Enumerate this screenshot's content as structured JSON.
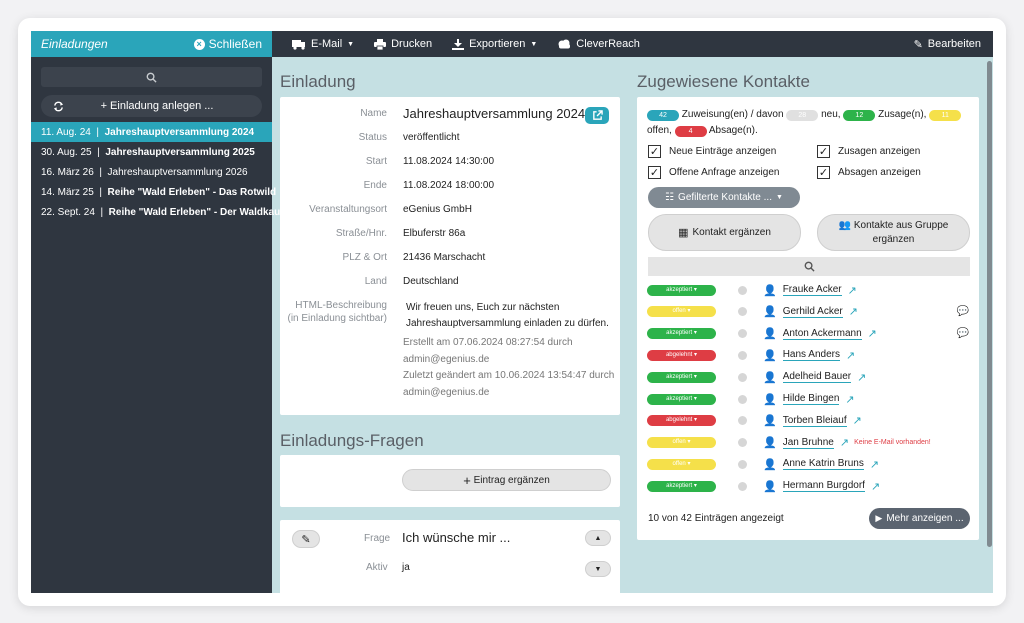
{
  "sidebar": {
    "title": "Einladungen",
    "close_label": "Schließen",
    "new_label": "Einladung anlegen ...",
    "items": [
      {
        "date": "11. Aug. 24",
        "name": "Jahreshauptversammlung 2024",
        "active": true
      },
      {
        "date": "30. Aug. 25",
        "name": "Jahreshauptversammlung 2025",
        "active": false
      },
      {
        "date": "16. März 26",
        "name": "Jahreshauptversammlung 2026",
        "active": false
      },
      {
        "date": "14. März 25",
        "name": "Reihe \"Wald Erleben\" - Das Rotwild",
        "active": false
      },
      {
        "date": "22. Sept. 24",
        "name": "Reihe \"Wald Erleben\" - Der Waldkauz",
        "active": false
      }
    ]
  },
  "toolbar": {
    "email": "E-Mail",
    "print": "Drucken",
    "export": "Exportieren",
    "cleverreach": "CleverReach",
    "edit": "Bearbeiten"
  },
  "invitation": {
    "heading": "Einladung",
    "name_label": "Name",
    "name": "Jahreshauptversammlung 2024",
    "status_label": "Status",
    "status": "veröffentlicht",
    "start_label": "Start",
    "start": "11.08.2024 14:30:00",
    "end_label": "Ende",
    "end": "11.08.2024 18:00:00",
    "venue_label": "Veranstaltungsort",
    "venue": "eGenius GmbH",
    "street_label": "Straße/Hnr.",
    "street": "Elbuferstr 86a",
    "zip_label": "PLZ & Ort",
    "zip": "21436 Marschacht",
    "country_label": "Land",
    "country": "Deutschland",
    "desc_label_1": "HTML-Beschreibung",
    "desc_label_2": "(in Einladung sichtbar)",
    "desc_1": "Wir freuen uns, Euch zur nächsten",
    "desc_2": "Jahreshauptversammlung einladen zu dürfen.",
    "created_1": "Erstellt am 07.06.2024 08:27:54 durch",
    "created_2": "admin@egenius.de",
    "modified_1": "Zuletzt geändert am 10.06.2024 13:54:47 durch",
    "modified_2": "admin@egenius.de"
  },
  "questions": {
    "heading": "Einladungs-Fragen",
    "add_label": "Eintrag ergänzen",
    "question_label": "Frage",
    "question": "Ich wünsche mir ...",
    "active_label": "Aktiv",
    "active": "ja"
  },
  "contacts": {
    "heading": "Zugewiesene Kontakte",
    "total": "42",
    "total_text": "Zuweisung(en) / davon",
    "new_count": "28",
    "new_text": "neu,",
    "accept_count": "12",
    "accept_text": "Zusage(n),",
    "open_count": "11",
    "open_text": "offen,",
    "reject_count": "4",
    "reject_text": "Absage(n).",
    "cb_new": "Neue Einträge anzeigen",
    "cb_accept": "Zusagen anzeigen",
    "cb_open": "Offene Anfrage anzeigen",
    "cb_reject": "Absagen anzeigen",
    "filter_label": "Gefilterte Kontakte ...",
    "add_contact": "Kontakt ergänzen",
    "add_group_1": "Kontakte aus Gruppe",
    "add_group_2": "ergänzen",
    "rows": [
      {
        "status": "akzeptiert",
        "kind": "ok",
        "name": "Frauke Acker",
        "chat": false,
        "note": ""
      },
      {
        "status": "offen",
        "kind": "open",
        "name": "Gerhild Acker",
        "chat": true,
        "note": ""
      },
      {
        "status": "akzeptiert",
        "kind": "ok",
        "name": "Anton Ackermann",
        "chat": true,
        "note": ""
      },
      {
        "status": "abgelehnt",
        "kind": "rej",
        "name": "Hans Anders",
        "chat": false,
        "note": ""
      },
      {
        "status": "akzeptiert",
        "kind": "ok",
        "name": "Adelheid Bauer",
        "chat": false,
        "note": ""
      },
      {
        "status": "akzeptiert",
        "kind": "ok",
        "name": "Hilde Bingen",
        "chat": false,
        "note": ""
      },
      {
        "status": "abgelehnt",
        "kind": "rej",
        "name": "Torben Bleiauf",
        "chat": false,
        "note": ""
      },
      {
        "status": "offen",
        "kind": "open",
        "name": "Jan Bruhne",
        "chat": false,
        "note": "Keine E-Mail vorhanden!"
      },
      {
        "status": "offen",
        "kind": "open",
        "name": "Anne Katrin Bruns",
        "chat": false,
        "note": ""
      },
      {
        "status": "akzeptiert",
        "kind": "ok",
        "name": "Hermann Burgdorf",
        "chat": false,
        "note": ""
      }
    ],
    "footer": "10 von 42 Einträgen angezeigt",
    "more_label": "Mehr anzeigen ..."
  },
  "colors": {
    "accent": "#2aa5ba",
    "dark": "#2f3640",
    "accepted": "#2db34a",
    "open": "#f5e04a",
    "rejected": "#de3d44",
    "background": "#c5e0e3"
  }
}
